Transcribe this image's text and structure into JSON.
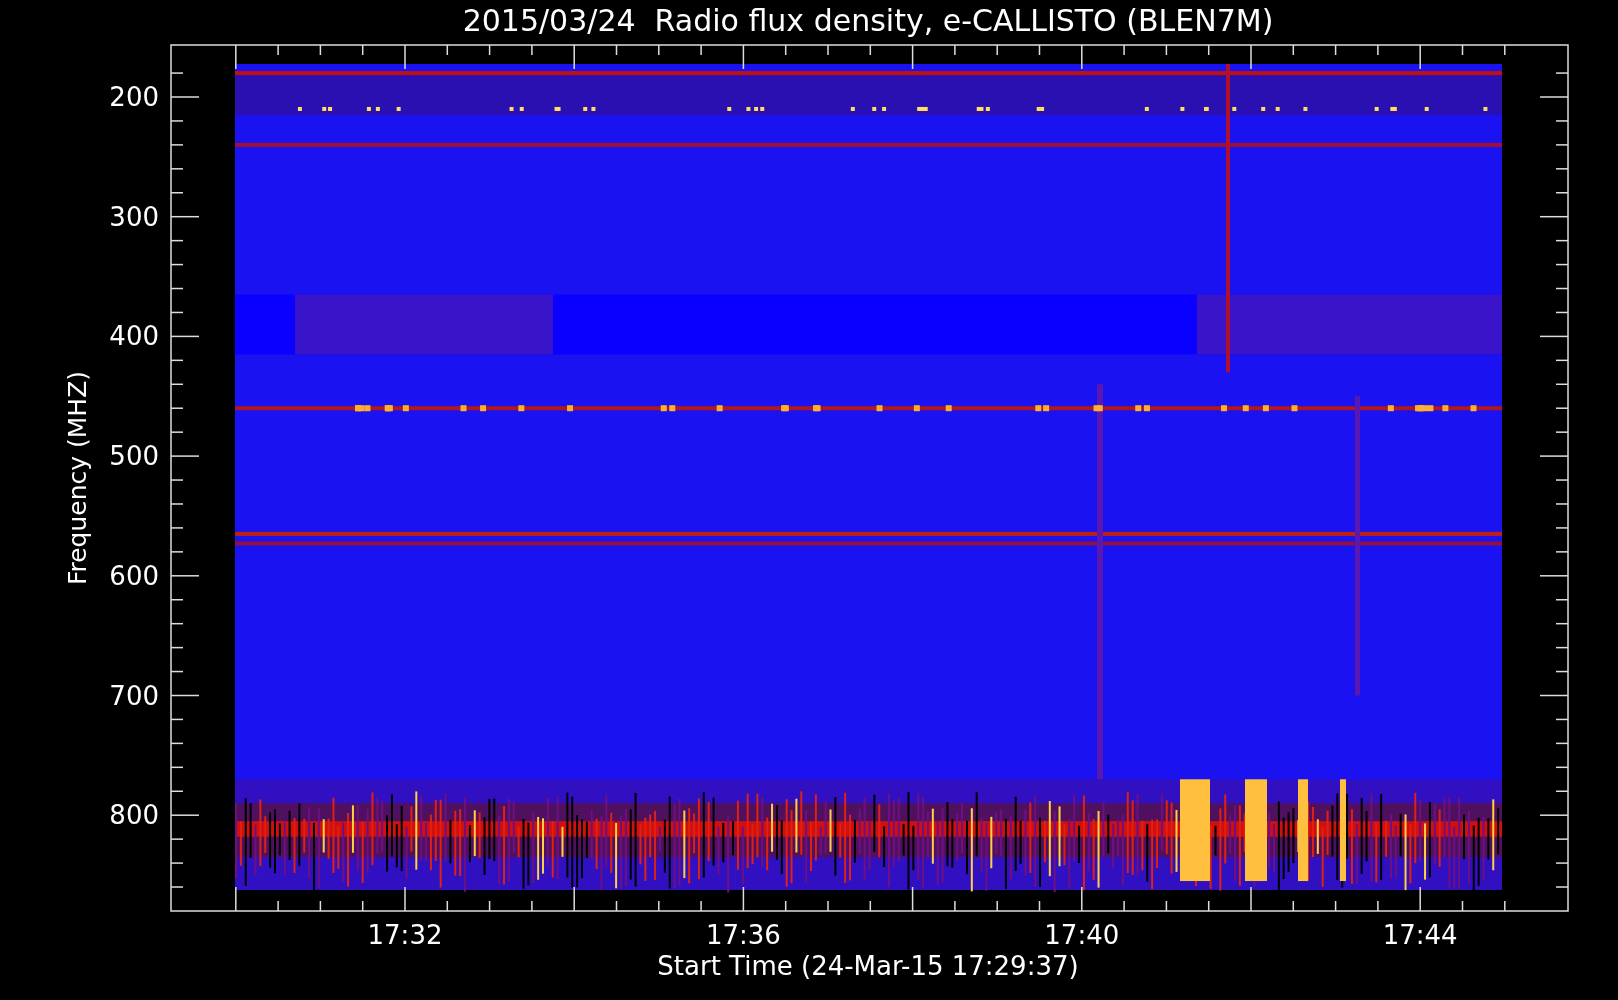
{
  "title": "2015/03/24  Radio flux density, e-CALLISTO (BLEN7M)",
  "y_axis": {
    "label": "Frequency (MHZ)",
    "ticks": [
      "200",
      "300",
      "400",
      "500",
      "600",
      "700",
      "800"
    ]
  },
  "x_axis": {
    "label": "Start Time (24-Mar-15 17:29:37)",
    "ticks": [
      "17:32",
      "17:36",
      "17:40",
      "17:44"
    ]
  }
}
